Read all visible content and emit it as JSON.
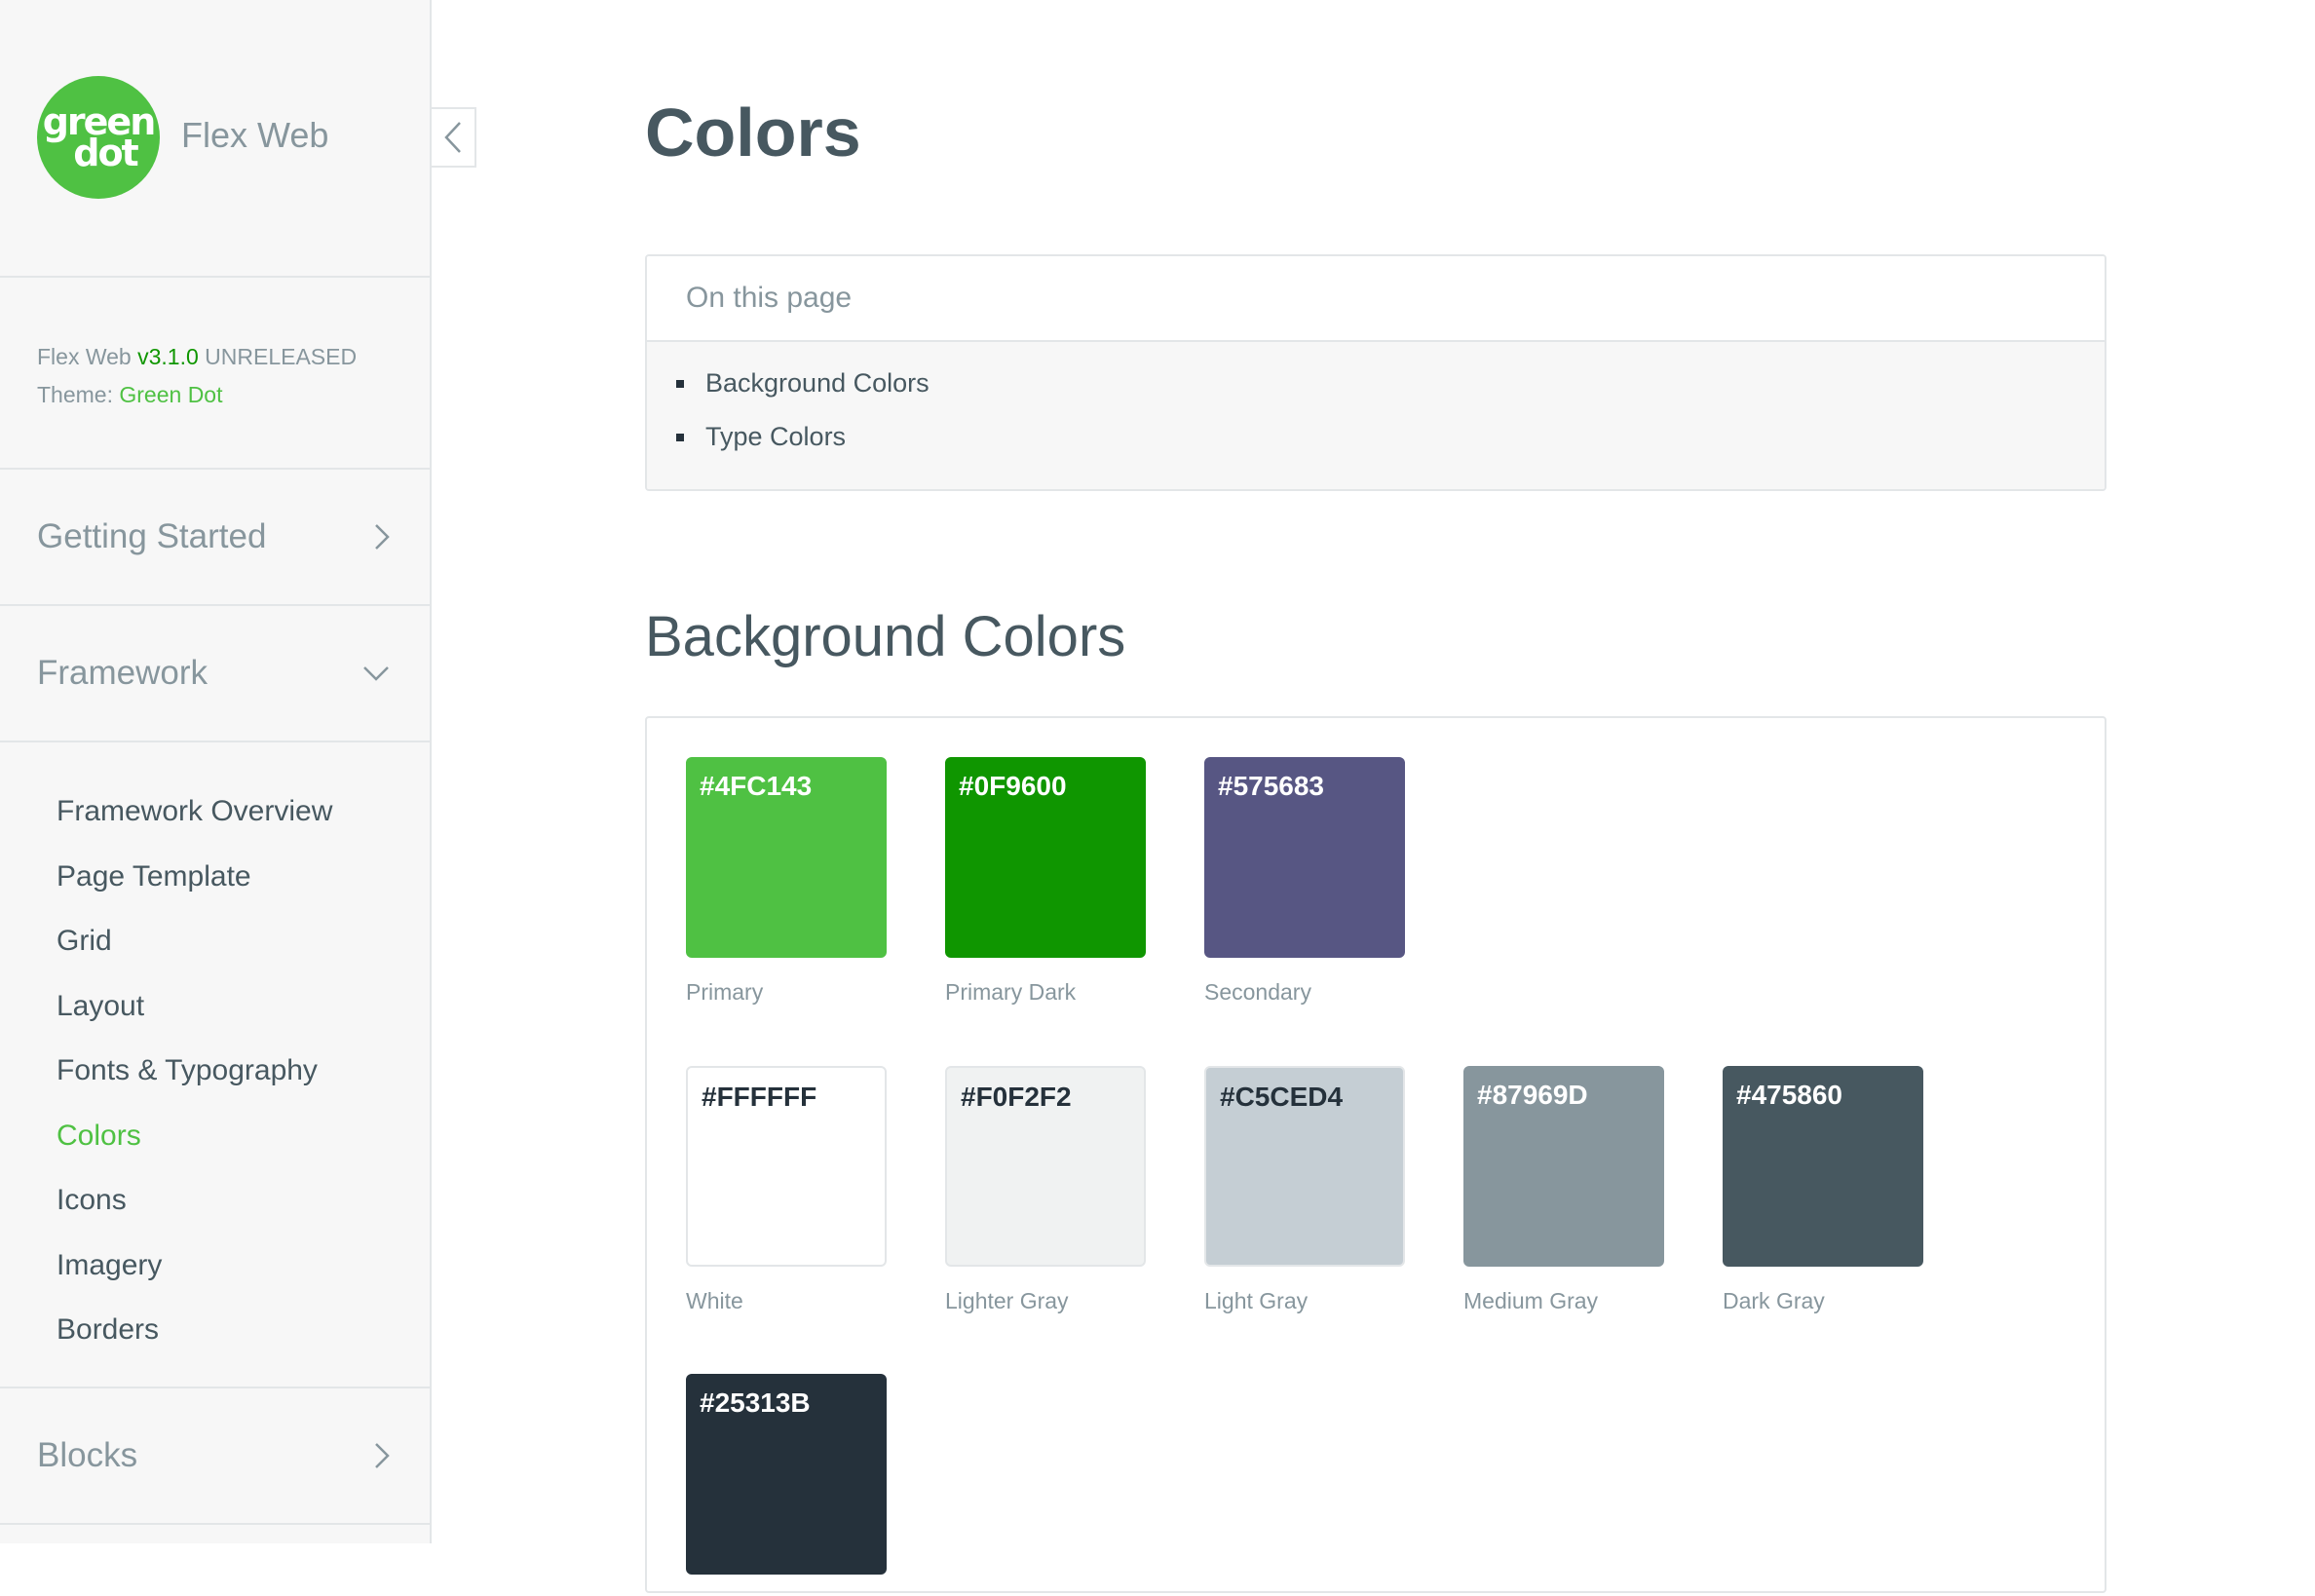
{
  "brand": {
    "logo_line1": "green",
    "logo_line2": "dot",
    "app_name": "Flex Web"
  },
  "version": {
    "prefix": "Flex Web ",
    "number": "v3.1.0",
    "status": " UNRELEASED",
    "theme_label": "Theme: ",
    "theme_name": "Green Dot"
  },
  "nav": {
    "getting_started": "Getting Started",
    "framework": "Framework",
    "framework_items": [
      "Framework Overview",
      "Page Template",
      "Grid",
      "Layout",
      "Fonts & Typography",
      "Colors",
      "Icons",
      "Imagery",
      "Borders"
    ],
    "active_item": "Colors",
    "blocks": "Blocks"
  },
  "main": {
    "title": "Colors",
    "toc": {
      "heading": "On this page",
      "items": [
        "Background Colors",
        "Type Colors"
      ]
    },
    "section_title": "Background Colors",
    "swatches": [
      {
        "hex": "#4FC143",
        "name": "Primary",
        "color": "#4fc143"
      },
      {
        "hex": "#0F9600",
        "name": "Primary Dark",
        "color": "#0f9600"
      },
      {
        "hex": "#575683",
        "name": "Secondary",
        "color": "#575683"
      },
      {
        "hex": "#FFFFFF",
        "name": "White",
        "color": "#ffffff"
      },
      {
        "hex": "#F0F2F2",
        "name": "Lighter Gray",
        "color": "#f0f2f2"
      },
      {
        "hex": "#C5CED4",
        "name": "Light Gray",
        "color": "#c5ced4"
      },
      {
        "hex": "#87969D",
        "name": "Medium Gray",
        "color": "#87969d"
      },
      {
        "hex": "#475860",
        "name": "Dark Gray",
        "color": "#475860"
      },
      {
        "hex": "#25313B",
        "name": "",
        "color": "#25313b"
      }
    ]
  },
  "colors": {
    "brand_green": "#4fc143",
    "accent_dark_green": "#0f9600",
    "text": "#475860",
    "muted": "#87969d"
  }
}
